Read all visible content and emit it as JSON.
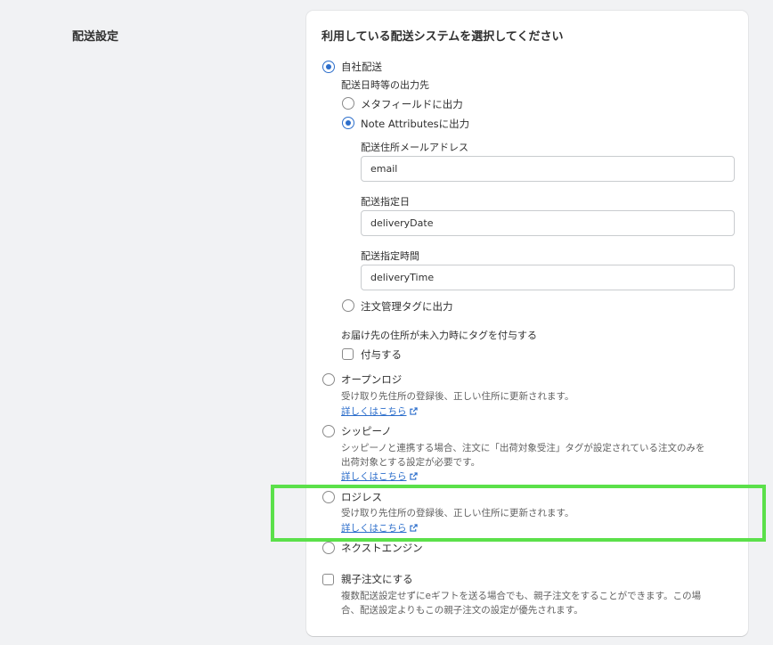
{
  "section": {
    "title": "配送設定"
  },
  "card": {
    "title": "利用している配送システムを選択してください",
    "own_delivery": {
      "label": "自社配送",
      "output_label": "配送日時等の出力先",
      "metafield_label": "メタフィールドに出力",
      "note_attr_label": "Note Attributesに出力",
      "fields": {
        "email_label": "配送住所メールアドレス",
        "email_value": "email",
        "date_label": "配送指定日",
        "date_value": "deliveryDate",
        "time_label": "配送指定時間",
        "time_value": "deliveryTime"
      },
      "order_tag_label": "注文管理タグに出力",
      "missing_address_label": "お届け先の住所が未入力時にタグを付与する",
      "add_tag_label": "付与する"
    },
    "openlogi": {
      "label": "オープンロジ",
      "help": "受け取り先住所の登録後、正しい住所に更新されます。",
      "link": "詳しくはこちら"
    },
    "shippino": {
      "label": "シッピーノ",
      "help_line1": "シッピーノと連携する場合、注文に「出荷対象受注」タグが設定されている注文のみを",
      "help_line2": "出荷対象とする設定が必要です。",
      "link": "詳しくはこちら"
    },
    "logiless": {
      "label": "ロジレス",
      "help": "受け取り先住所の登録後、正しい住所に更新されます。",
      "link": "詳しくはこちら"
    },
    "next_engine": {
      "label": "ネクストエンジン"
    },
    "parent_order": {
      "label": "親子注文にする",
      "help_line1": "複数配送設定せずにeギフトを送る場合でも、親子注文をすることができます。この場",
      "help_line2": "合、配送設定よりもこの親子注文の設定が優先されます。"
    }
  },
  "colors": {
    "accent": "#2c6ecb",
    "highlight": "#5be04a"
  },
  "icons": {
    "external_link": "external-link-icon"
  }
}
